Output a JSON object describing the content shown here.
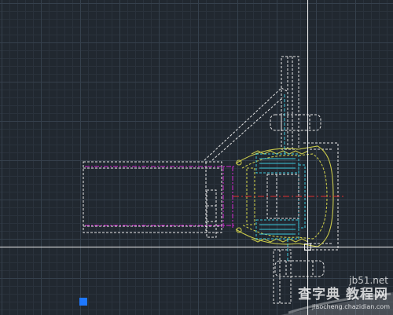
{
  "drawing": {
    "background_color": "#212830",
    "grid_minor_color": "#2a323c",
    "grid_major_color": "#35404c",
    "crosshair_color": "#f0f0f0",
    "colors": {
      "outline": "#e6e6e6",
      "centerline": "#d22ad2",
      "red_axis": "#e03030",
      "yellow_part": "#c8c84a",
      "cyan_part": "#3cc8dc",
      "ucs_marker": "#1e78ff"
    },
    "icons": {
      "ucs": "square-marker-icon"
    }
  },
  "watermark": {
    "site": "jb51.net",
    "title": "查字典 教程网",
    "url": "jiaocheng.chazidian.com"
  }
}
